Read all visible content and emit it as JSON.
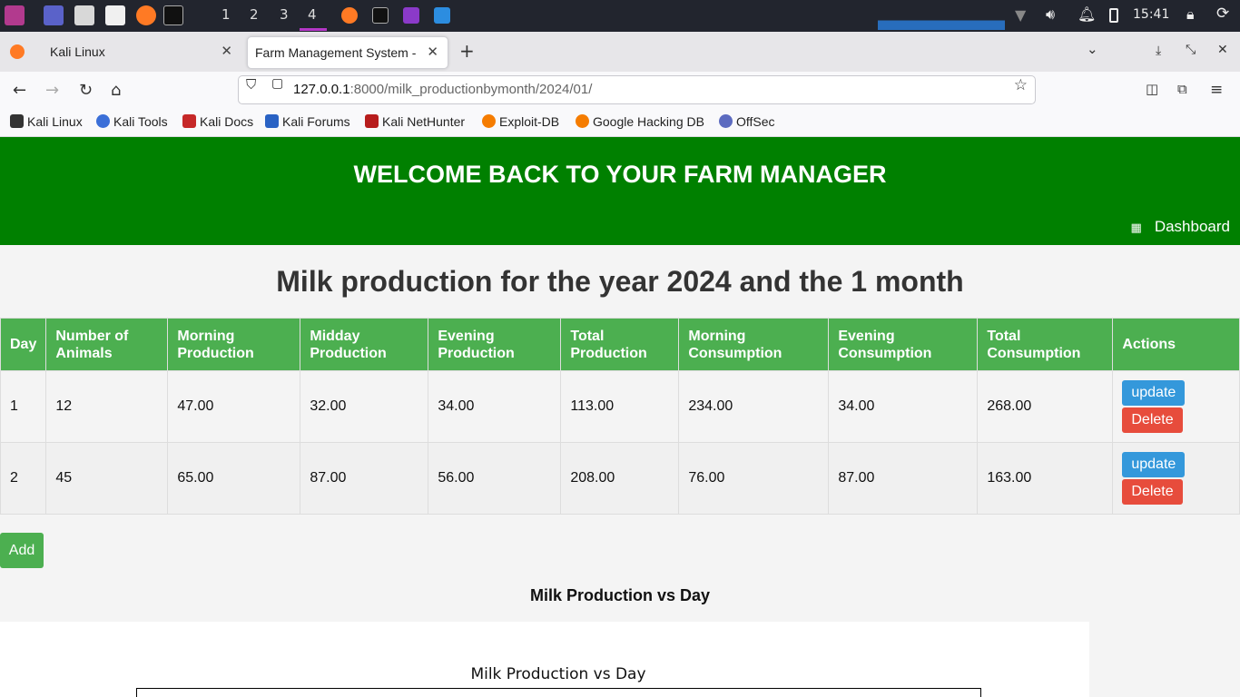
{
  "taskbar": {
    "workspaces": [
      "1",
      "2",
      "3",
      "4"
    ],
    "clock": "15:41"
  },
  "browser": {
    "tabs": [
      {
        "label": "Kali Linux"
      },
      {
        "label": "Farm Management System -"
      }
    ],
    "url_host": "127.0.0.1",
    "url_rest": ":8000/milk_productionbymonth/2024/01/",
    "bookmarks": [
      "Kali Linux",
      "Kali Tools",
      "Kali Docs",
      "Kali Forums",
      "Kali NetHunter",
      "Exploit-DB",
      "Google Hacking DB",
      "OffSec"
    ]
  },
  "header": {
    "title": "WELCOME BACK TO YOUR FARM MANAGER",
    "dashboard_label": "Dashboard"
  },
  "main": {
    "title": "Milk production for the year 2024 and the 1 month",
    "columns": [
      "Day",
      "Number of Animals",
      "Morning Production",
      "Midday Production",
      "Evening Production",
      "Total Production",
      "Morning Consumption",
      "Evening Consumption",
      "Total Consumption",
      "Actions"
    ],
    "rows": [
      {
        "day": "1",
        "animals": "12",
        "morning": "47.00",
        "midday": "32.00",
        "evening": "34.00",
        "total": "113.00",
        "morning_cons": "234.00",
        "evening_cons": "34.00",
        "total_cons": "268.00"
      },
      {
        "day": "2",
        "animals": "45",
        "morning": "65.00",
        "midday": "87.00",
        "evening": "56.00",
        "total": "208.00",
        "morning_cons": "76.00",
        "evening_cons": "87.00",
        "total_cons": "163.00"
      }
    ],
    "update_label": "update",
    "delete_label": "Delete",
    "add_label": "Add",
    "chart_heading": "Milk Production vs Day",
    "chart_title": "Milk Production vs Day"
  },
  "colors": {
    "header_green": "#008000",
    "table_header": "#4caf50",
    "update_blue": "#3498db",
    "delete_red": "#e74c3c"
  }
}
